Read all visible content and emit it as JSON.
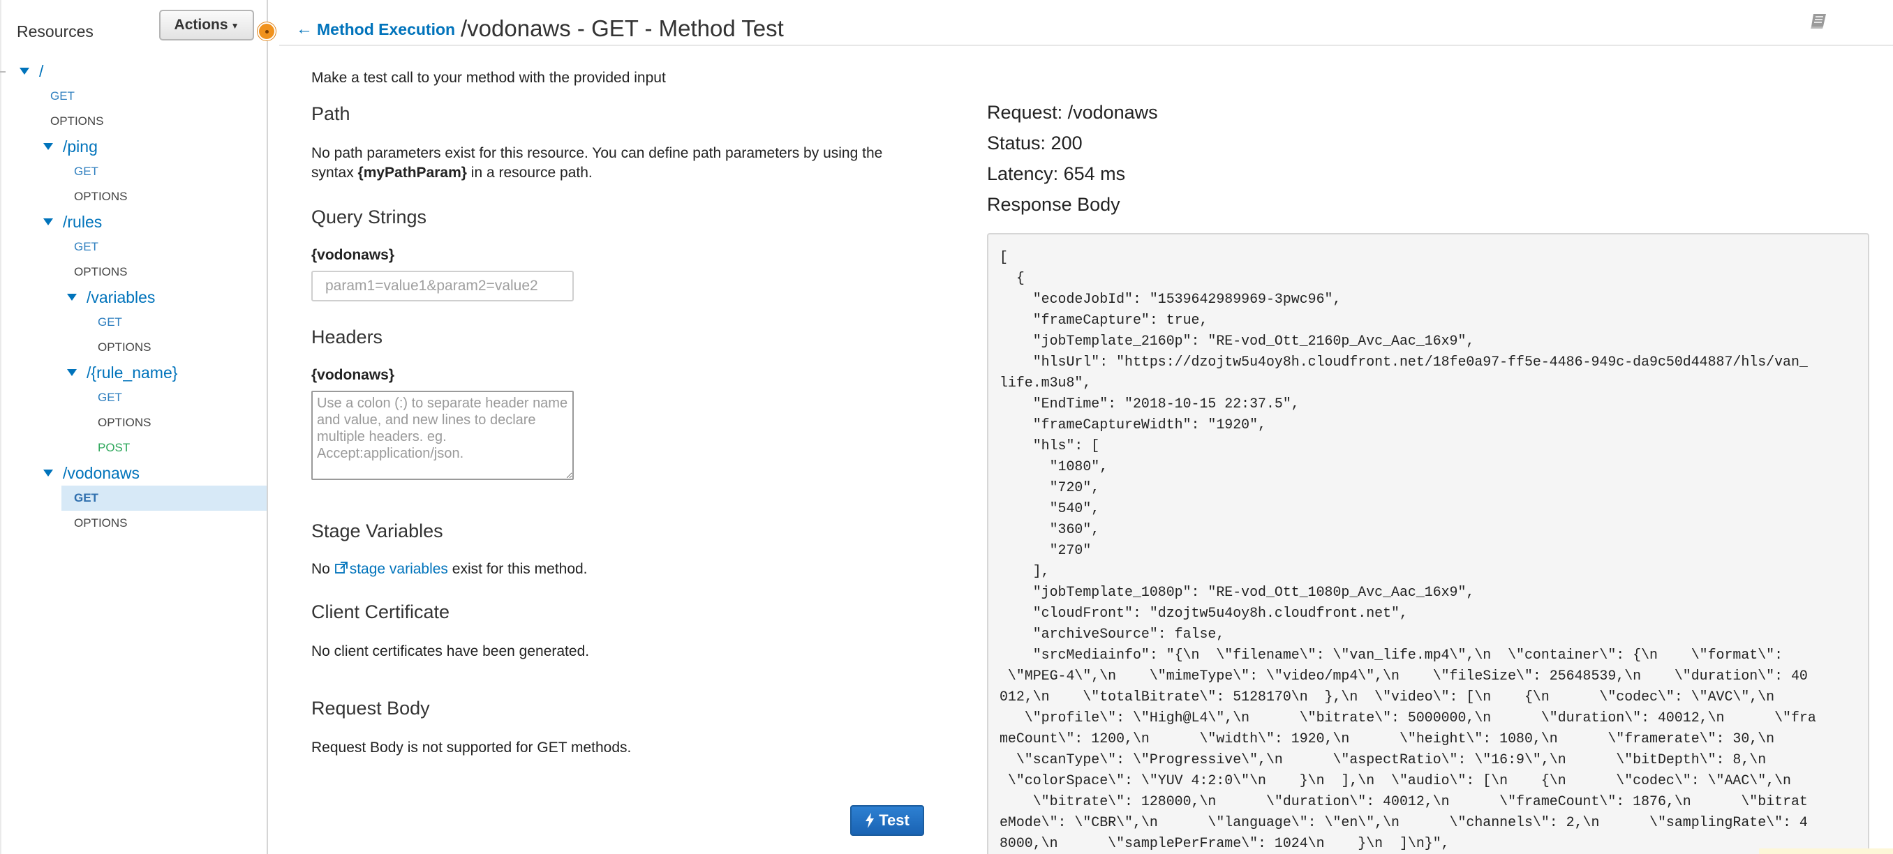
{
  "sidebar": {
    "title": "Resources",
    "actions_label": "Actions",
    "tree": [
      {
        "label": "/",
        "level": 0
      },
      {
        "method": "GET",
        "level": 0
      },
      {
        "method": "OPTIONS",
        "level": 0
      },
      {
        "label": "/ping",
        "level": 1
      },
      {
        "method": "GET",
        "level": 1
      },
      {
        "method": "OPTIONS",
        "level": 1
      },
      {
        "label": "/rules",
        "level": 1
      },
      {
        "method": "GET",
        "level": 1
      },
      {
        "method": "OPTIONS",
        "level": 1
      },
      {
        "label": "/variables",
        "level": 2
      },
      {
        "method": "GET",
        "level": 2
      },
      {
        "method": "OPTIONS",
        "level": 2
      },
      {
        "label": "/{rule_name}",
        "level": 2
      },
      {
        "method": "GET",
        "level": 2
      },
      {
        "method": "OPTIONS",
        "level": 2
      },
      {
        "method": "POST",
        "level": 2
      },
      {
        "label": "/vodonaws",
        "level": 1
      },
      {
        "method": "GET",
        "level": 1,
        "selected": true
      },
      {
        "method": "OPTIONS",
        "level": 1
      }
    ]
  },
  "header": {
    "back_label": "Method Execution",
    "title": "/vodonaws - GET - Method Test"
  },
  "test": {
    "intro": "Make a test call to your method with the provided input",
    "path": {
      "title": "Path",
      "text_line1": "No path parameters exist for this resource. You can define path parameters by using the",
      "text_line2_pre": "syntax ",
      "text_line2_bold": "{myPathParam}",
      "text_line2_post": " in a resource path."
    },
    "query_strings": {
      "title": "Query Strings",
      "param_label": "{vodonaws}",
      "placeholder": "param1=value1&param2=value2"
    },
    "headers": {
      "title": "Headers",
      "param_label": "{vodonaws}",
      "placeholder": "Use a colon (:) to separate header name and value, and new lines to declare multiple headers. eg. Accept:application/json."
    },
    "stage_variables": {
      "title": "Stage Variables",
      "pre": "No ",
      "link": "stage variables",
      "post": " exist for this method."
    },
    "client_certificate": {
      "title": "Client Certificate",
      "text": "No client certificates have been generated."
    },
    "request_body": {
      "title": "Request Body",
      "text": "Request Body is not supported for GET methods."
    },
    "test_button": "Test"
  },
  "response": {
    "request": "Request: /vodonaws",
    "status": "Status: 200",
    "latency": "Latency: 654 ms",
    "body_title": "Response Body",
    "body_lines": [
      "[",
      "  {",
      "    \"ecodeJobId\": \"1539642989969-3pwc96\",",
      "    \"frameCapture\": true,",
      "    \"jobTemplate_2160p\": \"RE-vod_Ott_2160p_Avc_Aac_16x9\",",
      "    \"hlsUrl\": \"https://dzojtw5u4oy8h.cloudfront.net/18fe0a97-ff5e-4486-949c-da9c50d44887/hls/van_",
      "life.m3u8\",",
      "    \"EndTime\": \"2018-10-15 22:37.5\",",
      "    \"frameCaptureWidth\": \"1920\",",
      "    \"hls\": [",
      "      \"1080\",",
      "      \"720\",",
      "      \"540\",",
      "      \"360\",",
      "      \"270\"",
      "    ],",
      "    \"jobTemplate_1080p\": \"RE-vod_Ott_1080p_Avc_Aac_16x9\",",
      "    \"cloudFront\": \"dzojtw5u4oy8h.cloudfront.net\",",
      "    \"archiveSource\": false,",
      "    \"srcMediainfo\": \"{\\n  \\\"filename\\\": \\\"van_life.mp4\\\",\\n  \\\"container\\\": {\\n    \\\"format\\\":",
      " \\\"MPEG-4\\\",\\n    \\\"mimeType\\\": \\\"video/mp4\\\",\\n    \\\"fileSize\\\": 25648539,\\n    \\\"duration\\\": 40",
      "012,\\n    \\\"totalBitrate\\\": 5128170\\n  },\\n  \\\"video\\\": [\\n    {\\n      \\\"codec\\\": \\\"AVC\\\",\\n",
      "   \\\"profile\\\": \\\"High@L4\\\",\\n      \\\"bitrate\\\": 5000000,\\n      \\\"duration\\\": 40012,\\n      \\\"fra",
      "meCount\\\": 1200,\\n      \\\"width\\\": 1920,\\n      \\\"height\\\": 1080,\\n      \\\"framerate\\\": 30,\\n",
      "  \\\"scanType\\\": \\\"Progressive\\\",\\n      \\\"aspectRatio\\\": \\\"16:9\\\",\\n      \\\"bitDepth\\\": 8,\\n",
      " \\\"colorSpace\\\": \\\"YUV 4:2:0\\\"\\n    }\\n  ],\\n  \\\"audio\\\": [\\n    {\\n      \\\"codec\\\": \\\"AAC\\\",\\n",
      "    \\\"bitrate\\\": 128000,\\n      \\\"duration\\\": 40012,\\n      \\\"frameCount\\\": 1876,\\n      \\\"bitrat",
      "eMode\\\": \\\"CBR\\\",\\n      \\\"language\\\": \\\"en\\\",\\n      \\\"channels\\\": 2,\\n      \\\"samplingRate\\\": 4",
      "8000,\\n      \\\"samplePerFrame\\\": 1024\\n    }\\n  ]\\n}\","
    ]
  },
  "icons": {
    "back": "arrow-left-icon",
    "book": "book-icon",
    "external": "external-link-icon",
    "bolt": "bolt-icon"
  },
  "colors": {
    "link": "#0073bb",
    "selected_row": "#d7e9f7",
    "post": "#2ea75b",
    "accent_orange": "#f0921e",
    "test_button": "#1a63b3"
  }
}
